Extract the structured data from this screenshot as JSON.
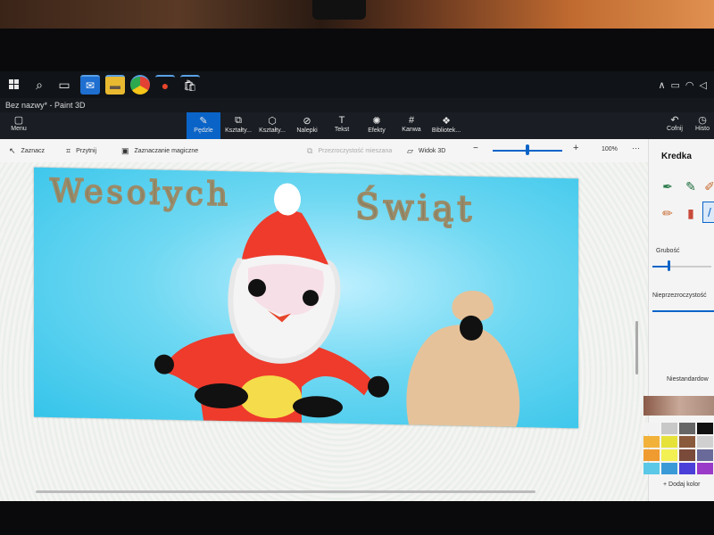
{
  "window_title": "Bez nazwy* - Paint 3D",
  "taskbar": {
    "apps": [
      "mail-icon",
      "folder-icon",
      "chrome-icon",
      "paint3d-icon",
      "store-icon"
    ]
  },
  "ribbon": {
    "menu_label": "Menu",
    "tools": [
      {
        "label": "Pędzle",
        "icon": "brush-icon",
        "active": true
      },
      {
        "label": "Kształty...",
        "icon": "shapes2d-icon",
        "active": false
      },
      {
        "label": "Kształty...",
        "icon": "shapes3d-icon",
        "active": false
      },
      {
        "label": "Nalepki",
        "icon": "sticker-icon",
        "active": false
      },
      {
        "label": "Tekst",
        "icon": "text-icon",
        "active": false
      },
      {
        "label": "Efekty",
        "icon": "effects-icon",
        "active": false
      },
      {
        "label": "Kanwa",
        "icon": "canvas-icon",
        "active": false
      },
      {
        "label": "Bibliotek...",
        "icon": "library-icon",
        "active": false
      }
    ],
    "undo_label": "Cofnij",
    "history_label": "Histo"
  },
  "options": {
    "select_label": "Zaznacz",
    "crop_label": "Przytnij",
    "magic_select_label": "Zaznaczanie magiczne",
    "transparency_label": "Przezroczystość mieszana",
    "view3d_label": "Widok 3D",
    "zoom_value": "100%",
    "more_label": "···"
  },
  "canvas_text": {
    "line1": "Wesołych",
    "line2": "Świąt"
  },
  "panel": {
    "title": "Kredka",
    "thickness_label": "Grubość",
    "thickness_value": 0.27,
    "opacity_label": "Nieprzezroczystość",
    "custom_label": "Niestandardow",
    "add_color_label": "Dodaj kolor"
  },
  "colors": {
    "accent": "#0a64c8",
    "canvas_bg": "#35c4ea",
    "santa_red": "#ee3b2c",
    "palette": [
      "#f2f2f2",
      "#c8c8c8",
      "#666666",
      "#111111",
      "#f2b23a",
      "#e6e23a",
      "#8a5a3c",
      "#d0d0d0",
      "#f09b2f",
      "#f2f052",
      "#7a4a3a",
      "#6a6a9a",
      "#5ac8e6",
      "#3a9ad8",
      "#4a3fd8",
      "#9a3ac8"
    ]
  }
}
